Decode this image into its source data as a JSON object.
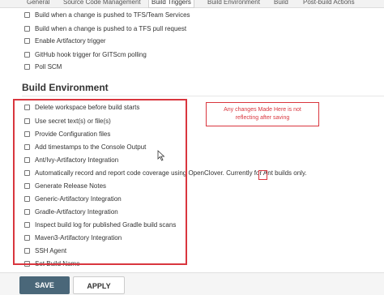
{
  "tabs": [
    {
      "label": "General"
    },
    {
      "label": "Source Code Management"
    },
    {
      "label": "Build Triggers"
    },
    {
      "label": "Build Environment"
    },
    {
      "label": "Build"
    },
    {
      "label": "Post-build Actions"
    }
  ],
  "active_tab": "Build Triggers",
  "triggers": [
    {
      "label": "Build when a change is pushed to TFS/Team Services"
    },
    {
      "label": "Build when a change is pushed to a TFS pull request"
    },
    {
      "label": "Enable Artifactory trigger"
    },
    {
      "label": "GitHub hook trigger for GITScm polling"
    },
    {
      "label": "Poll SCM"
    }
  ],
  "build_environment": {
    "title": "Build Environment",
    "options": [
      {
        "label": "Delete workspace before build starts"
      },
      {
        "label": "Use secret text(s) or file(s)"
      },
      {
        "label": "Provide Configuration files"
      },
      {
        "label": "Add timestamps to the Console Output"
      },
      {
        "label": "Ant/Ivy-Artifactory Integration"
      },
      {
        "label": "Automatically record and report code coverage using OpenClover. Currently for Ant builds only."
      },
      {
        "label": "Generate Release Notes"
      },
      {
        "label": "Generic-Artifactory Integration"
      },
      {
        "label": "Gradle-Artifactory Integration"
      },
      {
        "label": "Inspect build log for published Gradle build scans"
      },
      {
        "label": "Maven3-Artifactory Integration"
      },
      {
        "label": "SSH Agent"
      },
      {
        "label": "Set Build Name"
      }
    ]
  },
  "annotation": {
    "line1": "Any changes Made Here is not",
    "line2": "reflecting after saving",
    "color": "#d9363e"
  },
  "buttons": {
    "save": "SAVE",
    "apply": "APPLY"
  }
}
